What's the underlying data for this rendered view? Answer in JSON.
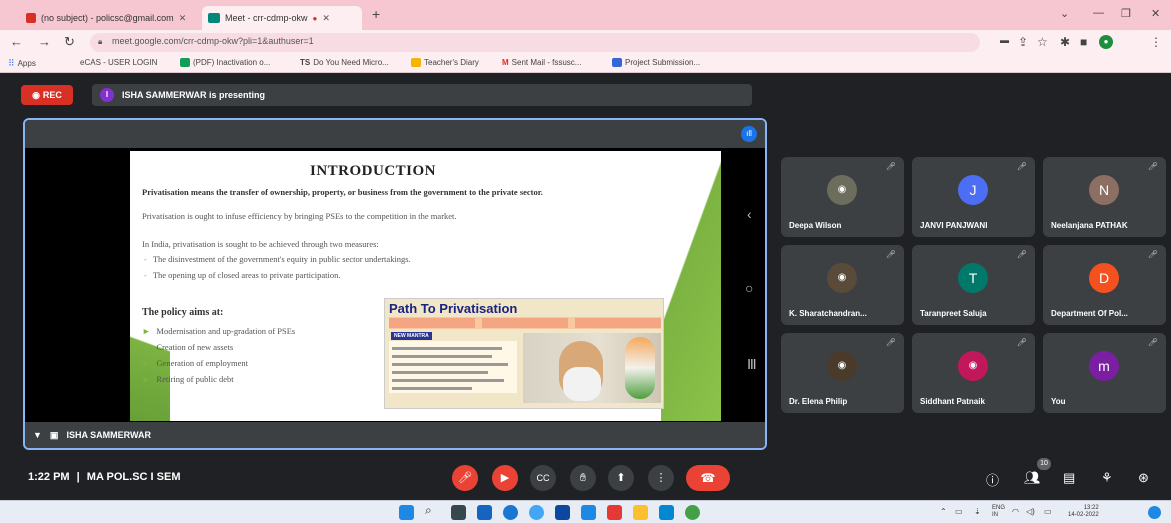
{
  "browser": {
    "tabs": [
      {
        "title": "(no subject) - policsc@gmail.com",
        "favicon_color": "#d93025"
      },
      {
        "title": "Meet - crr-cdmp-okw",
        "favicon_color": "#00897b"
      }
    ],
    "new_tab": "+",
    "url": "meet.google.com/crr-cdmp-okw?pli=1&authuser=1",
    "bookmarks": [
      {
        "label": "Apps",
        "color": "#4285f4"
      },
      {
        "label": "eCAS - USER LOGIN",
        "color": "#9e9e9e"
      },
      {
        "label": "(PDF) Inactivation o...",
        "color": "#0f9d58"
      },
      {
        "label": "Do You Need Micro...",
        "color": "#444444"
      },
      {
        "label": "Teacher's Diary",
        "color": "#f4b400"
      },
      {
        "label": "Sent Mail - fssusc...",
        "color": "#d93025"
      },
      {
        "label": "Project Submission...",
        "color": "#3367d6"
      }
    ]
  },
  "meet": {
    "rec_label": "REC",
    "presenter_initial": "I",
    "presenting_text": "ISHA SAMMERWAR is presenting",
    "stage_footer_name": "ISHA SAMMERWAR",
    "slide": {
      "title": "INTRODUCTION",
      "para1": "Privatisation means the transfer of ownership, property, or business from the government to the private sector.",
      "para2": "Privatisation is ought to infuse efficiency by bringing PSEs to the competition in the market.",
      "para3": "In India, privatisation is sought to be achieved through two measures:",
      "measures": [
        "The disinvestment of the government's equity in public sector undertakings.",
        "The opening up of closed areas to private participation."
      ],
      "policy_heading": "The policy aims at:",
      "aims": [
        "Modernisation and up-gradation of PSEs",
        "Creation of new assets",
        "Generation of employment",
        "Retiring of public debt"
      ],
      "inset_title": "Path To Privatisation",
      "inset_tag": "NEW MANTRA"
    },
    "participants": [
      {
        "name": "Deepa Wilson",
        "initial": "",
        "color": "#5f6368",
        "photo": true
      },
      {
        "name": "JANVI PANJWANI",
        "initial": "J",
        "color": "#4c6ef5",
        "photo": false
      },
      {
        "name": "Neelanjana PATHAK",
        "initial": "N",
        "color": "#8d6e63",
        "photo": false
      },
      {
        "name": "K. Sharatchandran...",
        "initial": "",
        "color": "#5f6368",
        "photo": true
      },
      {
        "name": "Taranpreet Saluja",
        "initial": "T",
        "color": "#00796b",
        "photo": false
      },
      {
        "name": "Department Of Pol...",
        "initial": "D",
        "color": "#f4511e",
        "photo": false
      },
      {
        "name": "Dr. Elena Philip",
        "initial": "",
        "color": "#5f6368",
        "photo": true
      },
      {
        "name": "Siddhant Patnaik",
        "initial": "",
        "color": "#5f6368",
        "photo": true
      },
      {
        "name": "You",
        "initial": "m",
        "color": "#7b1fa2",
        "photo": false
      }
    ],
    "time": "1:22 PM",
    "separator": "|",
    "meeting_name": "MA POL.SC I SEM",
    "participant_count": "10"
  },
  "taskbar": {
    "lang": "ENG",
    "region": "IN",
    "time": "13:22",
    "date": "14-02-2022"
  }
}
